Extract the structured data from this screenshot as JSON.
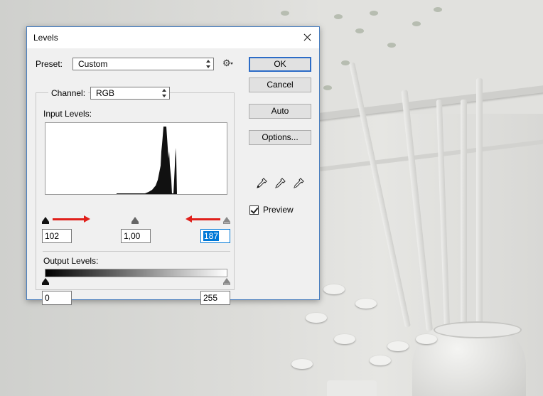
{
  "dialog": {
    "title": "Levels",
    "preset_label": "Preset:",
    "preset_value": "Custom",
    "channel_label": "Channel:",
    "channel_value": "RGB",
    "input_levels_label": "Input Levels:",
    "input_black": "102",
    "input_gamma": "1,00",
    "input_white": "187",
    "output_levels_label": "Output Levels:",
    "output_black": "0",
    "output_white": "255",
    "buttons": {
      "ok": "OK",
      "cancel": "Cancel",
      "auto": "Auto",
      "options": "Options..."
    },
    "preview_label": "Preview",
    "preview_checked": true
  },
  "colors": {
    "accent": "#0078d7",
    "annotation_arrow": "#e0201b",
    "dialog_border": "#4a7fbf"
  },
  "icons": [
    "close-icon",
    "settings-gear-icon",
    "black-eyedropper-icon",
    "gray-eyedropper-icon",
    "white-eyedropper-icon",
    "checkmark-icon"
  ]
}
